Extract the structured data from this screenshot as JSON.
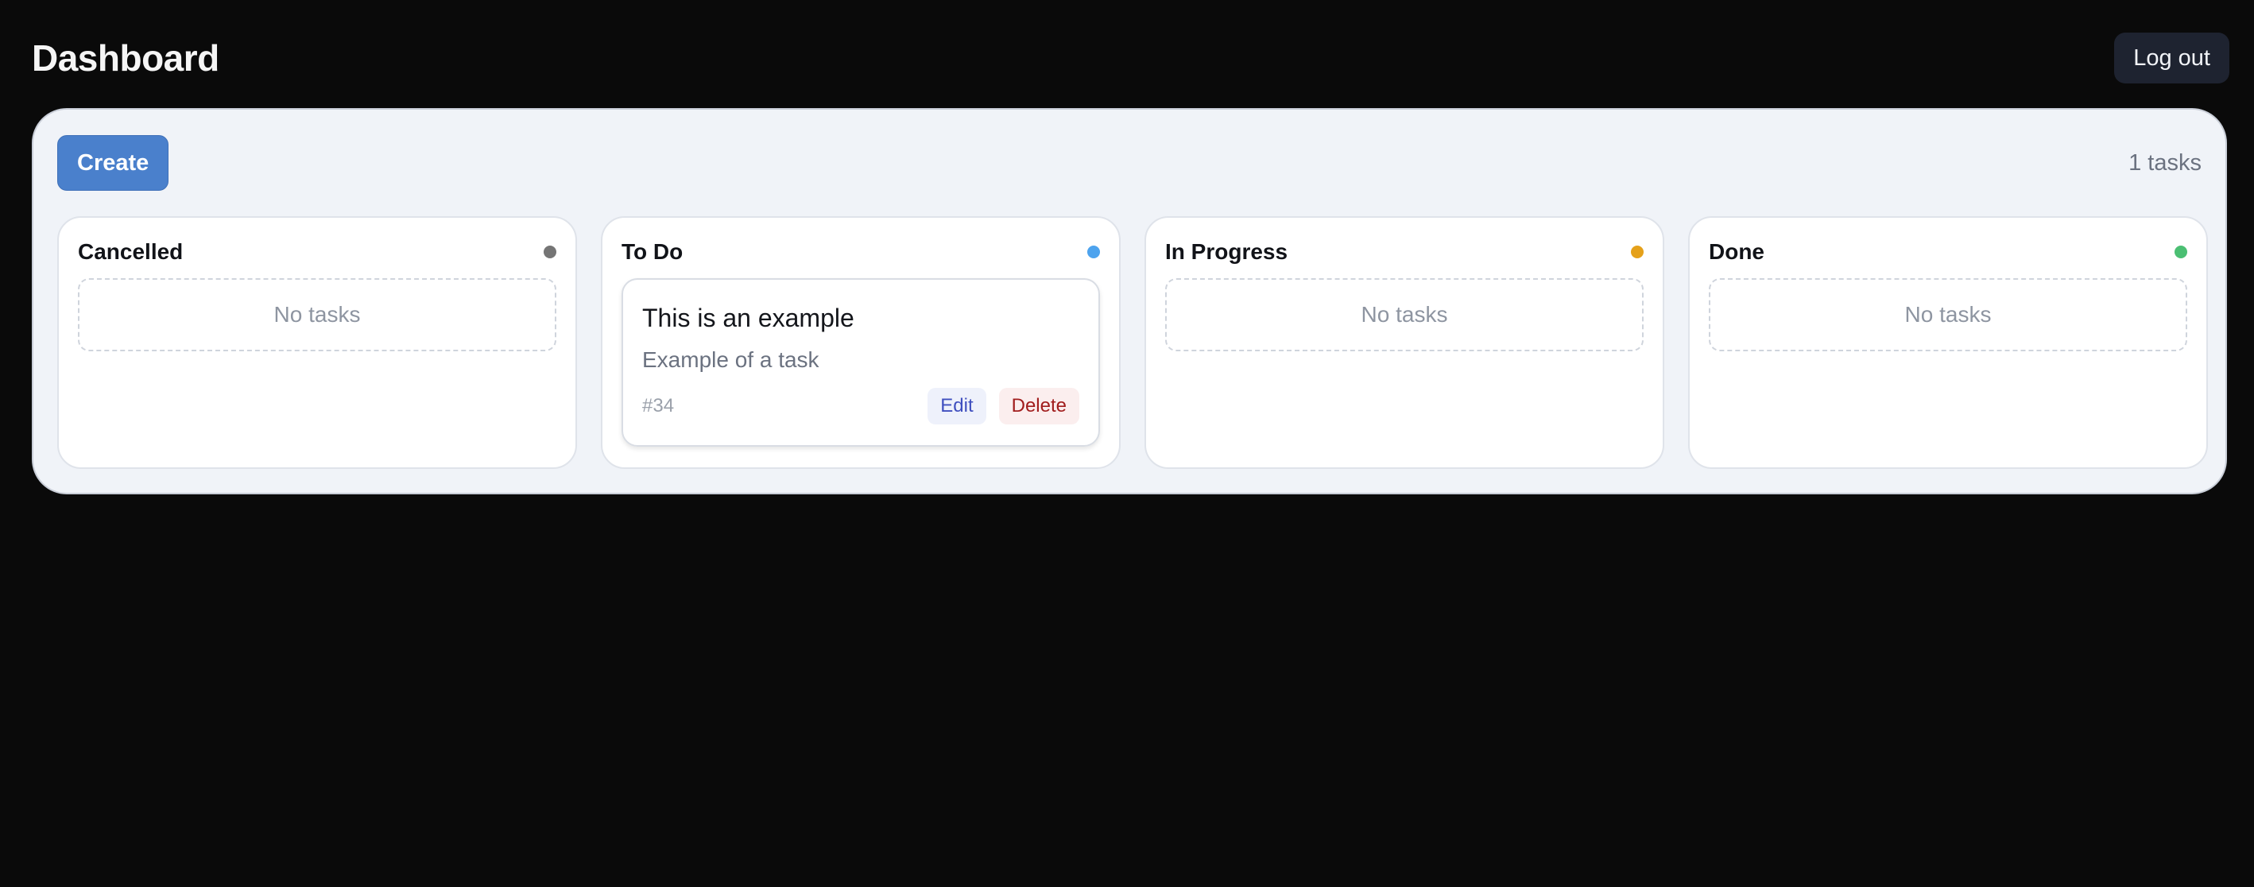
{
  "header": {
    "title": "Dashboard",
    "logout_label": "Log out"
  },
  "board": {
    "create_label": "Create",
    "task_count": "1 tasks"
  },
  "columns": [
    {
      "title": "Cancelled",
      "dot_color": "#757575",
      "empty_text": "No tasks"
    },
    {
      "title": "To Do",
      "dot_color": "#4da3ee"
    },
    {
      "title": "In Progress",
      "dot_color": "#e5a11a",
      "empty_text": "No tasks"
    },
    {
      "title": "Done",
      "dot_color": "#4bbf73",
      "empty_text": "No tasks"
    }
  ],
  "task": {
    "title": "This is an example",
    "description": "Example of a task",
    "id": "#34",
    "edit_label": "Edit",
    "delete_label": "Delete"
  }
}
